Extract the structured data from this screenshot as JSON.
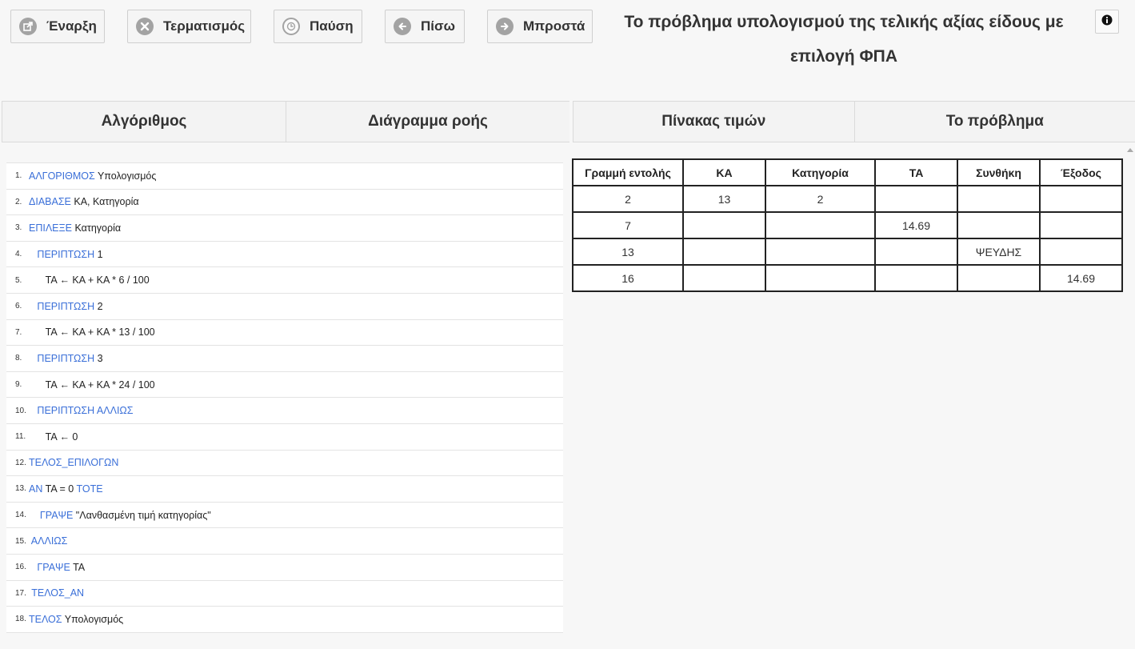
{
  "toolbar": {
    "start_label": "Έναρξη",
    "stop_label": "Τερματισμός",
    "pause_label": "Παύση",
    "back_label": "Πίσω",
    "forward_label": "Μπροστά"
  },
  "title": {
    "line1": "Το πρόβλημα υπολογισμού της τελικής αξίας είδους με",
    "line2": "επιλογή ΦΠΑ"
  },
  "tabs_left": [
    "Αλγόριθμος",
    "Διάγραμμα ροής"
  ],
  "tabs_right": [
    "Πίνακας τιμών",
    "Το πρόβλημα"
  ],
  "algorithm": [
    {
      "n": "1.",
      "indent": "",
      "kw": "ΑΛΓΟΡΙΘΜΟΣ",
      "rest": " Υπολογισμός"
    },
    {
      "n": "2.",
      "indent": "",
      "kw": "ΔΙΑΒΑΣΕ",
      "rest": " ΚΑ, Κατηγορία"
    },
    {
      "n": "3.",
      "indent": "",
      "kw": "ΕΠΙΛΕΞΕ",
      "rest": " Κατηγορία"
    },
    {
      "n": "4.",
      "indent": "   ",
      "kw": "ΠΕΡΙΠΤΩΣΗ",
      "rest": " 1"
    },
    {
      "n": "5.",
      "indent": "      ",
      "kw": "",
      "rest": "ΤΑ ← ΚΑ + ΚΑ * 6 / 100"
    },
    {
      "n": "6.",
      "indent": "   ",
      "kw": "ΠΕΡΙΠΤΩΣΗ",
      "rest": " 2"
    },
    {
      "n": "7.",
      "indent": "      ",
      "kw": "",
      "rest": "ΤΑ ← ΚΑ + ΚΑ * 13 / 100"
    },
    {
      "n": "8.",
      "indent": "   ",
      "kw": "ΠΕΡΙΠΤΩΣΗ",
      "rest": " 3"
    },
    {
      "n": "9.",
      "indent": "      ",
      "kw": "",
      "rest": "ΤΑ ← ΚΑ + ΚΑ * 24 / 100"
    },
    {
      "n": "10.",
      "indent": "   ",
      "kw": "ΠΕΡΙΠΤΩΣΗ ΑΛΛΙΩΣ",
      "rest": ""
    },
    {
      "n": "11.",
      "indent": "      ",
      "kw": "",
      "rest": "ΤΑ ← 0"
    },
    {
      "n": "12.",
      "indent": "",
      "kw": "ΤΕΛΟΣ_ΕΠΙΛΟΓΩΝ",
      "rest": ""
    },
    {
      "n": "13.",
      "indent": "",
      "kw": "ΑΝ",
      "rest": " ΤΑ = 0 ",
      "kw2": "ΤΟΤΕ"
    },
    {
      "n": "14.",
      "indent": "    ",
      "kw": "ΓΡΑΨΕ",
      "rest": " \"Λανθασμένη τιμή κατηγορίας\""
    },
    {
      "n": "15.",
      "indent": " ",
      "kw": "ΑΛΛΙΩΣ",
      "rest": ""
    },
    {
      "n": "16.",
      "indent": "   ",
      "kw": "ΓΡΑΨΕ",
      "rest": " ΤΑ"
    },
    {
      "n": "17.",
      "indent": " ",
      "kw": "ΤΕΛΟΣ_ΑΝ",
      "rest": ""
    },
    {
      "n": "18.",
      "indent": "",
      "kw": "ΤΕΛΟΣ",
      "rest": " Υπολογισμός"
    }
  ],
  "values_table": {
    "headers": [
      "Γραμμή εντολής",
      "ΚΑ",
      "Κατηγορία",
      "ΤΑ",
      "Συνθήκη",
      "Έξοδος"
    ],
    "rows": [
      [
        "2",
        "13",
        "2",
        "",
        "",
        ""
      ],
      [
        "7",
        "",
        "",
        "14.69",
        "",
        ""
      ],
      [
        "13",
        "",
        "",
        "",
        "ΨΕΥΔΗΣ",
        ""
      ],
      [
        "16",
        "",
        "",
        "",
        "",
        "14.69"
      ]
    ]
  }
}
